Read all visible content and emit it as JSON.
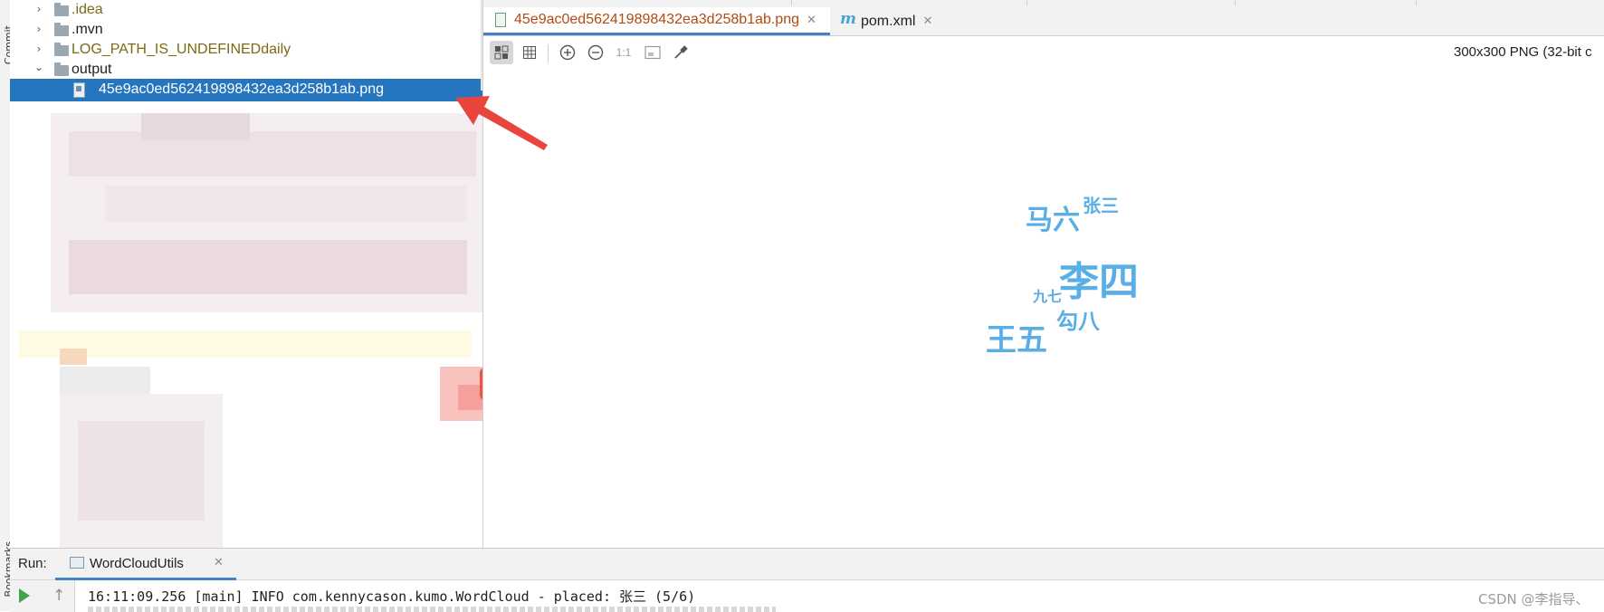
{
  "side_strip": {
    "commit_label": "Commit",
    "bookmarks_label": "Bookmarks"
  },
  "project_tree": {
    "items": [
      {
        "label": ".idea",
        "expanded": false
      },
      {
        "label": ".mvn",
        "expanded": false
      },
      {
        "label": "LOG_PATH_IS_UNDEFINEDdaily",
        "expanded": false
      },
      {
        "label": "output",
        "expanded": true
      },
      {
        "label": "45e9ac0ed562419898432ea3d258b1ab.png",
        "selected": true
      }
    ]
  },
  "editor": {
    "tabs": [
      {
        "label": "45e9ac0ed562419898432ea3d258b1ab.png",
        "active": true
      },
      {
        "label": "pom.xml",
        "active": false
      }
    ],
    "toolbar": {
      "actual_size_label": "1:1",
      "icons": [
        "chessboard-icon",
        "grid-icon",
        "zoom-in-icon",
        "zoom-out-icon",
        "fit-window-icon",
        "color-picker-icon"
      ]
    },
    "image_info": "300x300 PNG (32-bit c",
    "word_cloud": {
      "words": [
        "马六",
        "张三",
        "李四",
        "九七",
        "勾八",
        "王五"
      ],
      "color": "#5aaee6"
    }
  },
  "run_panel": {
    "run_label": "Run:",
    "tab_label": "WordCloudUtils",
    "console_line": "16:11:09.256 [main] INFO com.kennycason.kumo.WordCloud - placed: 张三 (5/6)",
    "watermark": "CSDN @李指导、"
  },
  "colors": {
    "selection": "#2675bf",
    "active_tab_text": "#b34a10",
    "folder_olive_text": "#7a6a14",
    "arrow": "#e8453c",
    "tab_underline": "#4083c9"
  }
}
